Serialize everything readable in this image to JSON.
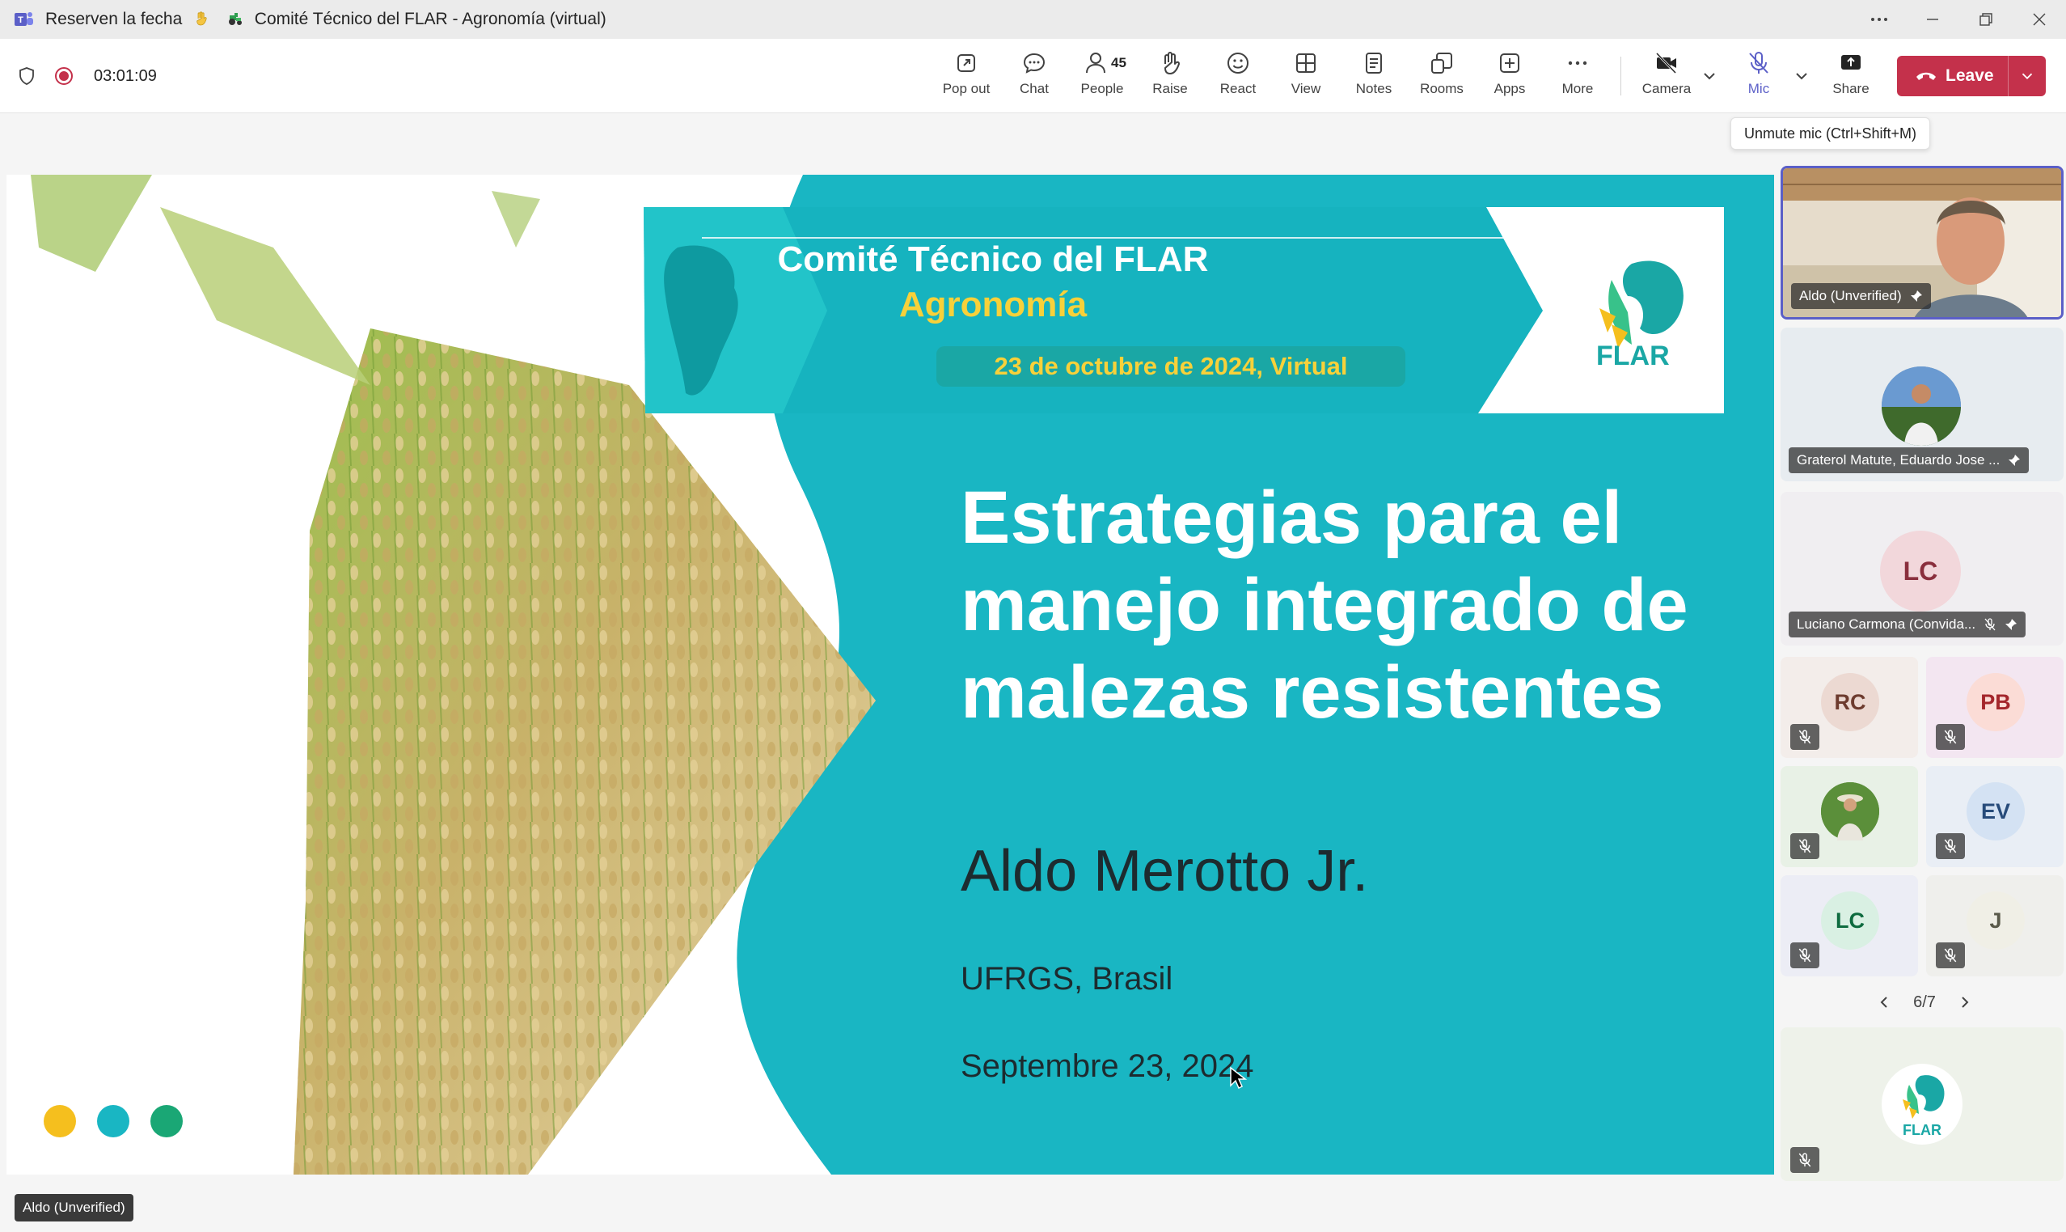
{
  "window": {
    "title_prefix": "Reserven la fecha",
    "title_main": "Comité Técnico del FLAR - Agronomía (virtual)"
  },
  "toolbar": {
    "timer": "03:01:09",
    "buttons": {
      "popout": "Pop out",
      "chat": "Chat",
      "people": "People",
      "people_count": "45",
      "raise": "Raise",
      "react": "React",
      "view": "View",
      "notes": "Notes",
      "rooms": "Rooms",
      "apps": "Apps",
      "more": "More",
      "camera": "Camera",
      "mic": "Mic",
      "share": "Share",
      "leave": "Leave"
    },
    "tooltip": "Unmute mic (Ctrl+Shift+M)"
  },
  "slide": {
    "banner_title": "Comité Técnico del FLAR",
    "banner_subtitle": "Agronomía",
    "banner_date": "23 de octubre de 2024, Virtual",
    "logo_text": "FLAR",
    "heading_lines": [
      "Estrategias para el",
      "manejo integrado de",
      "malezas resistentes"
    ],
    "author": "Aldo Merotto Jr.",
    "affiliation": "UFRGS, Brasil",
    "date": "Septembre 23, 2024",
    "colors": {
      "teal": "#19b6c3",
      "yellow": "#f5bf1e",
      "green": "#1aa775"
    }
  },
  "stage_label": "Aldo (Unverified)",
  "participants": {
    "pinned": [
      {
        "name": "Aldo (Unverified)"
      },
      {
        "name": "Graterol Matute, Eduardo Jose ..."
      },
      {
        "name": "Luciano Carmona (Convida...",
        "initials": "LC"
      }
    ],
    "grid": [
      {
        "initials": "RC"
      },
      {
        "initials": "PB"
      },
      {
        "initials": ""
      },
      {
        "initials": "EV"
      },
      {
        "initials": "LC"
      },
      {
        "initials": "J"
      }
    ],
    "page": "6/7",
    "bottom_logo_text": "FLAR"
  },
  "accent": "#5b5fc7",
  "leave_color": "#c4314b"
}
